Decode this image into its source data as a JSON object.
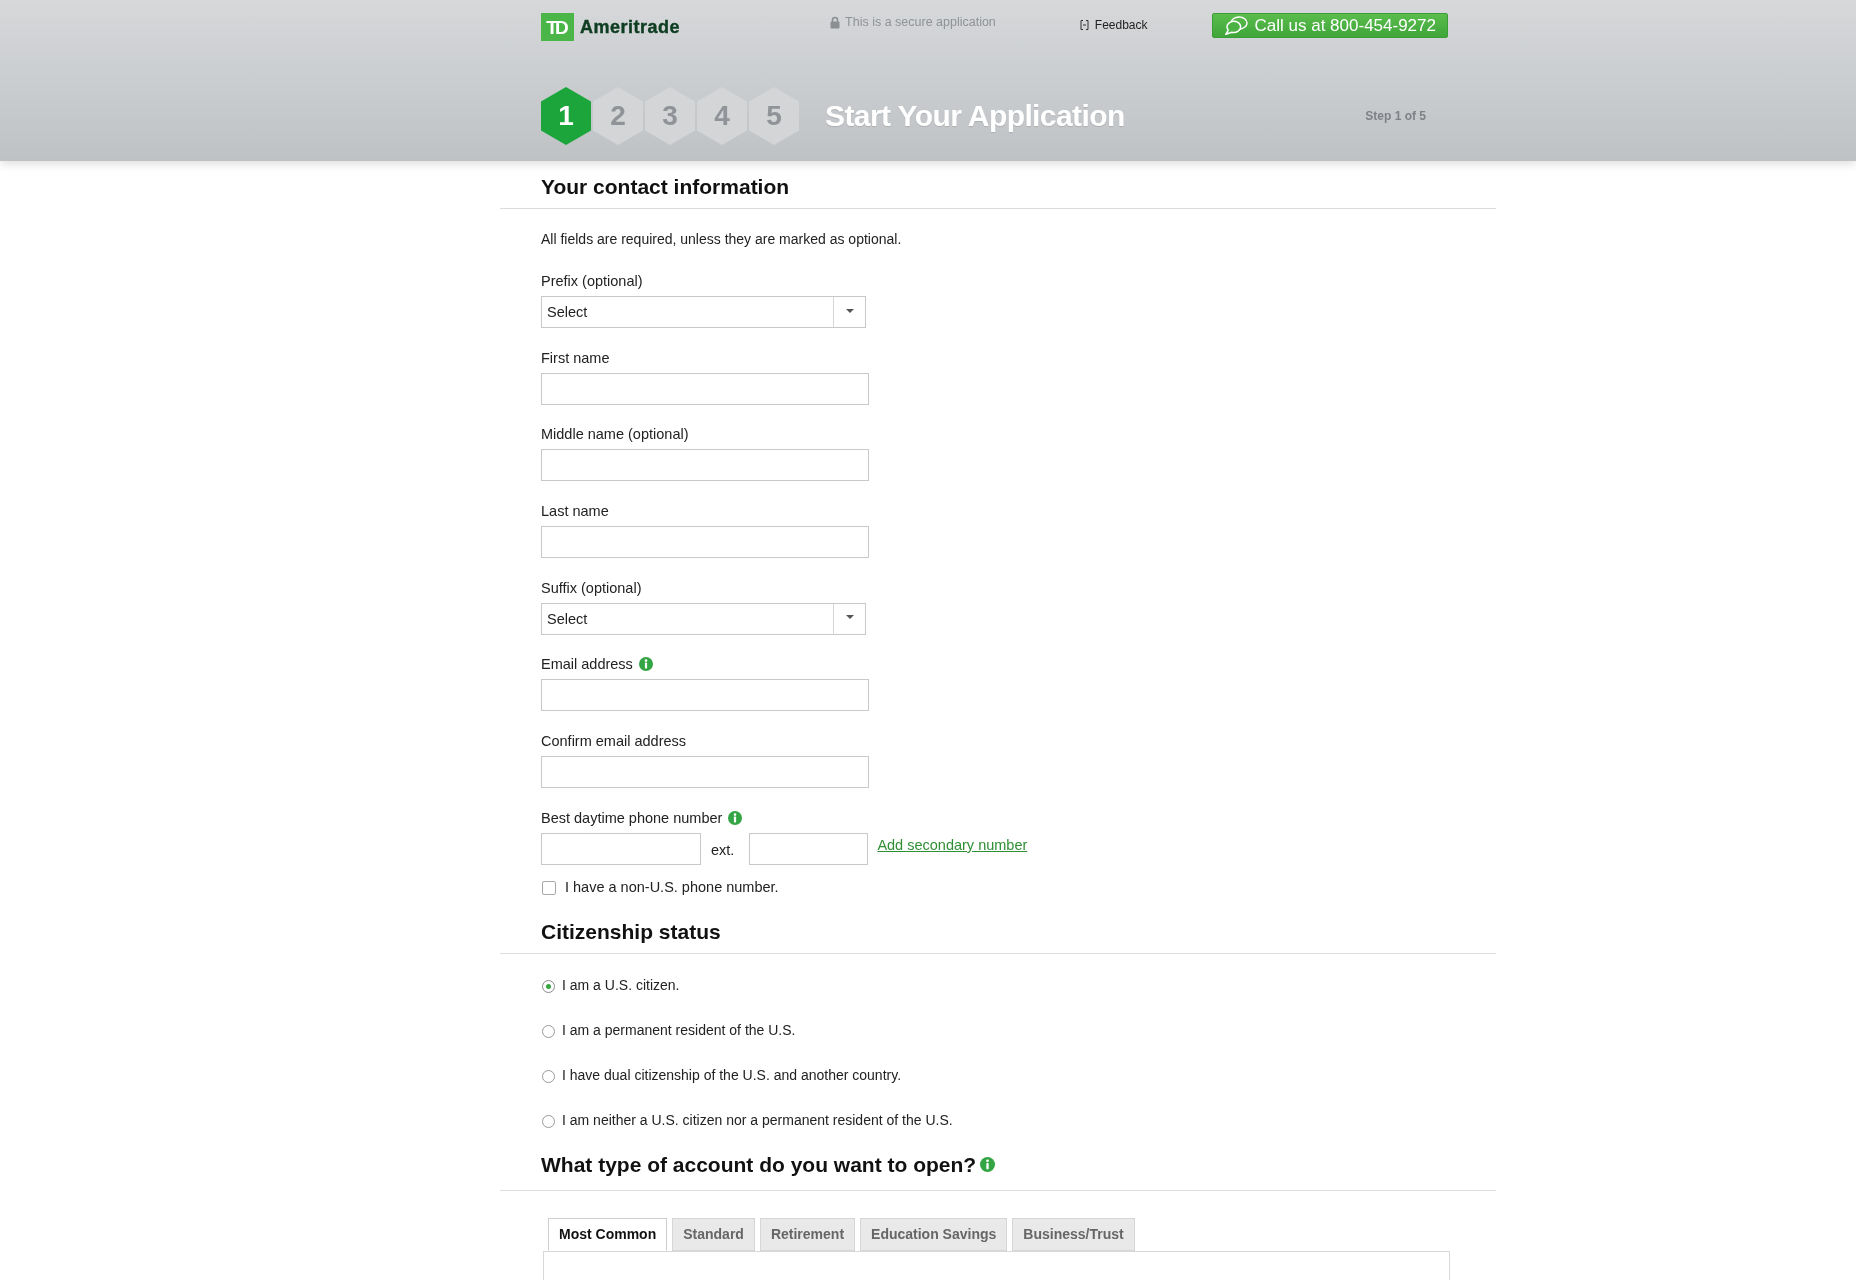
{
  "header": {
    "logo": {
      "mark": "TD",
      "name": "Ameritrade"
    },
    "secure_note": "This is a secure application",
    "feedback": "Feedback",
    "call_button": "Call us at 800-454-9272"
  },
  "progress": {
    "steps": [
      {
        "label": "1",
        "selected": true
      },
      {
        "label": "2",
        "selected": false
      },
      {
        "label": "3",
        "selected": false
      },
      {
        "label": "4",
        "selected": false
      },
      {
        "label": "5",
        "selected": false
      }
    ],
    "title": "Start Your Application",
    "step_counter": "Step 1 of 5"
  },
  "contact_section": {
    "heading": "Your contact information",
    "note": "All fields are required, unless they are marked as optional.",
    "fields": [
      {
        "kind": "select",
        "label": "Prefix (optional)",
        "value": "Select"
      },
      {
        "kind": "text",
        "label": "First name"
      },
      {
        "kind": "text",
        "label": "Middle name (optional)"
      },
      {
        "kind": "text",
        "label": "Last name"
      },
      {
        "kind": "select",
        "label": "Suffix (optional)",
        "value": "Select"
      },
      {
        "kind": "text",
        "label": "Email address",
        "info": true
      },
      {
        "kind": "text",
        "label": "Confirm email address"
      },
      {
        "kind": "phone",
        "label": "Best daytime phone number",
        "info": true,
        "ext_label": "ext.",
        "link": "Add secondary number"
      }
    ],
    "non_us_phone": {
      "label": "I have a non-U.S. phone number.",
      "checked": false
    }
  },
  "citizenship": {
    "heading": "Citizenship status",
    "options": [
      {
        "label": "I am a U.S. citizen.",
        "selected": true
      },
      {
        "label": "I am a permanent resident of the U.S.",
        "selected": false
      },
      {
        "label": "I have dual citizenship of the U.S. and another country.",
        "selected": false
      },
      {
        "label": "I am neither a U.S. citizen nor a permanent resident of the U.S.",
        "selected": false
      }
    ]
  },
  "account_type": {
    "heading": "What type of account do you want to open?",
    "info": true,
    "tabs": [
      {
        "label": "Most Common",
        "selected": true
      },
      {
        "label": "Standard",
        "selected": false
      },
      {
        "label": "Retirement",
        "selected": false
      },
      {
        "label": "Education Savings",
        "selected": false
      },
      {
        "label": "Business/Trust",
        "selected": false
      }
    ]
  }
}
